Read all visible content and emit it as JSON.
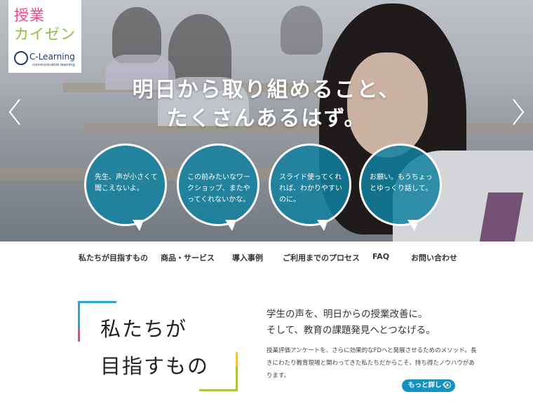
{
  "logo": {
    "line1": "授業",
    "line2": "カイゼン",
    "brand": "C-Learning",
    "brand_sub": "communication learning"
  },
  "hero": {
    "headline": [
      "明日から取り組めること、",
      "たくさんあるはず。"
    ],
    "bubbles": [
      "先生、声が小さくて聞こえないよ。",
      "この前みたいなワークショップ、またやってくれないかな。",
      "スライド使ってくれれば、わかりやすいのに。",
      "お願い。もうちょっとゆっくり話して。"
    ]
  },
  "nav": {
    "items": [
      "私たちが目指すもの",
      "商品・サービス",
      "導入事例",
      "ご利用までのプロセス",
      "FAQ",
      "お問い合わせ"
    ]
  },
  "mission": {
    "title": [
      "私たちが",
      "目指すもの"
    ],
    "lead": [
      "学生の声を、明日からの授業改善に。",
      "そして、教育の課題発見へとつなげる。"
    ],
    "body": "授業評価アンケートを、さらに効果的なFDへと発展させるためのメソッド。長きにわたり教育現場と関わってきた私たちだからこそ、持ち得たノウハウがあります。",
    "more_label": "もっと詳しく"
  },
  "colors": {
    "accent": "#1592c4",
    "bubble": "#1280a0",
    "pink": "#e8478b",
    "green": "#8fbf3e",
    "navy": "#1d3c6e"
  }
}
